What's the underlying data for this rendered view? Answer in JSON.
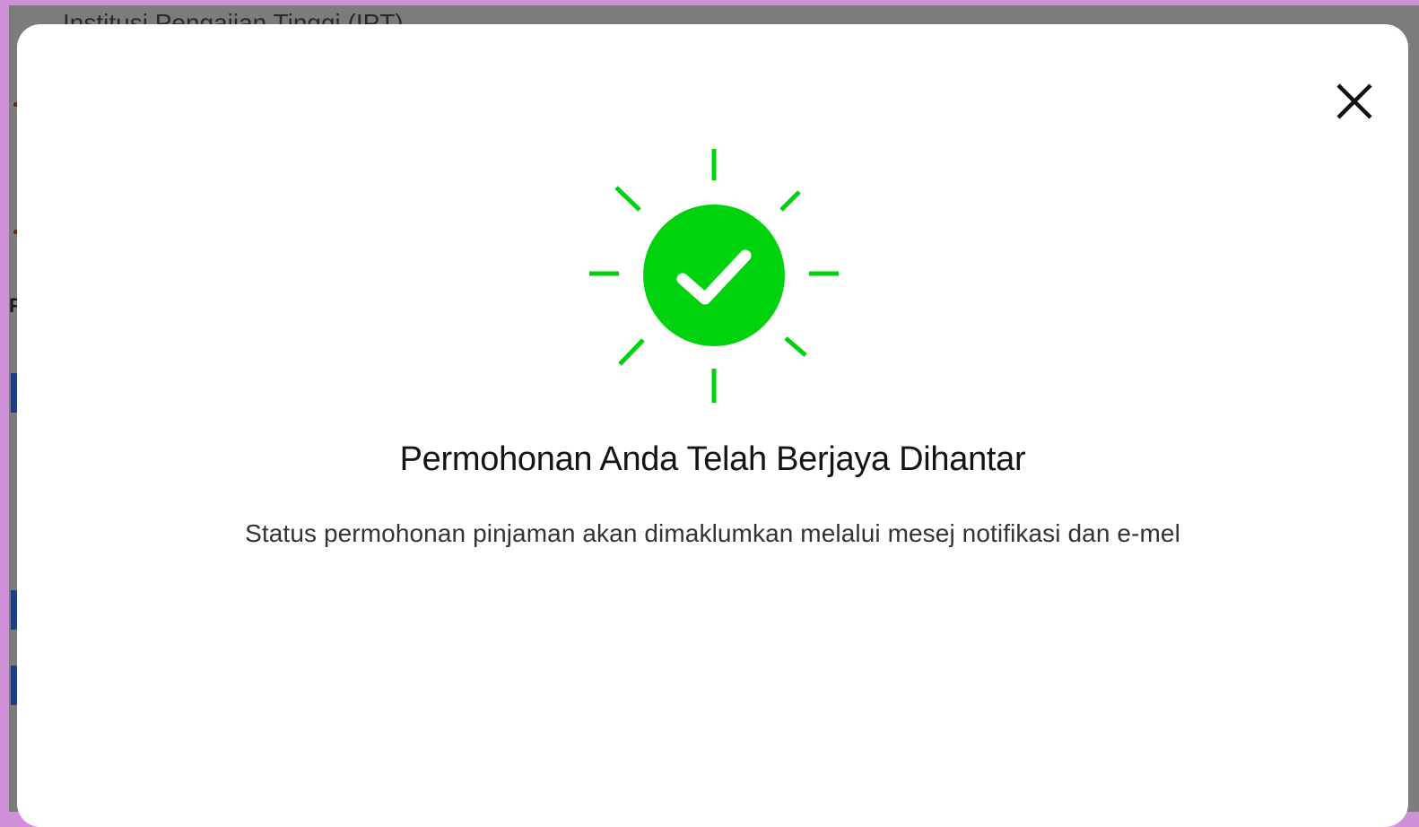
{
  "background_page": {
    "partial_heading": "Institusi Pengajian Tinggi (IPT)",
    "partial_glyph": "P"
  },
  "modal": {
    "title": "Permohonan Anda Telah Berjaya Dihantar",
    "message": "Status permohonan pinjaman akan dimaklumkan melalui mesej notifikasi dan e-mel",
    "close_icon": "close-icon",
    "status_icon": "success-check-icon"
  },
  "colors": {
    "overlay": "#7c7c7c",
    "outer_border": "#cf8fd9",
    "success_green": "#00d30e",
    "title_text": "#141414",
    "message_text": "#333333",
    "background_marker": "#1e3f84"
  }
}
